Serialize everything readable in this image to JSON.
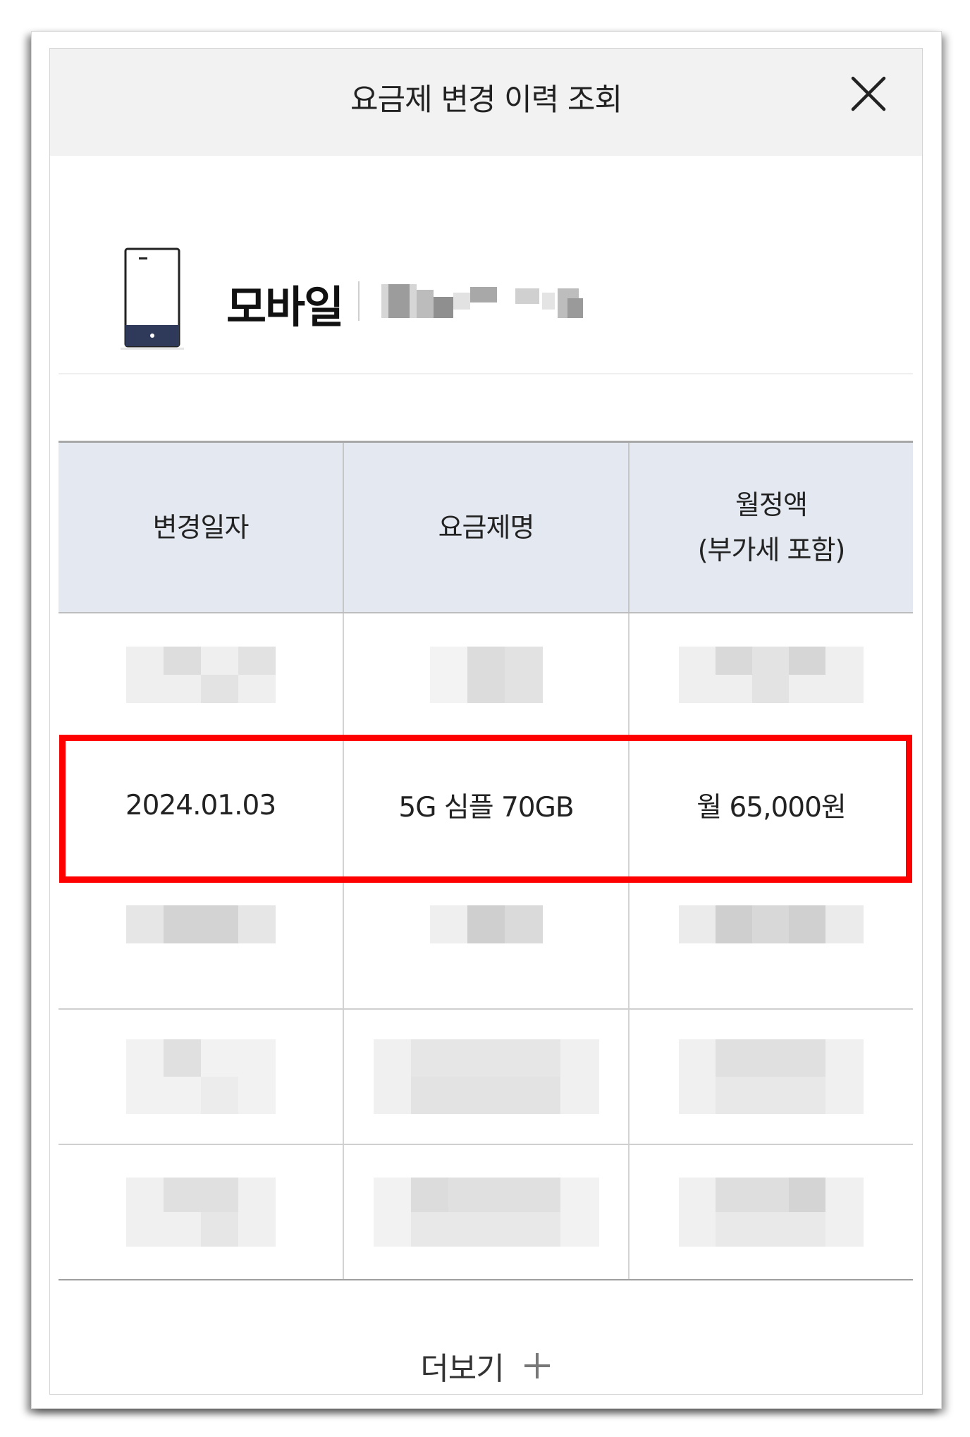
{
  "header": {
    "title": "요금제 변경 이력 조회",
    "close_icon": "close-icon"
  },
  "account": {
    "icon": "smartphone-icon",
    "type_label": "모바일",
    "number_masked": true
  },
  "table": {
    "columns": [
      "변경일자",
      "요금제명",
      "월정액"
    ],
    "column3_sub": "(부가세 포함)",
    "rows": [
      {
        "masked": true
      },
      {
        "date": "2024.01.03",
        "plan": "5G 심플 70GB",
        "price": "월 65,000원",
        "highlighted": true
      },
      {
        "masked": true
      },
      {
        "masked": true
      },
      {
        "masked": true
      }
    ]
  },
  "footer": {
    "more_label": "더보기",
    "more_icon": "plus-icon"
  },
  "colors": {
    "header_bg": "#f2f2f2",
    "table_header_bg": "#e4e9f1",
    "highlight": "#ff0000",
    "phone_bottom": "#2f3a5a"
  }
}
